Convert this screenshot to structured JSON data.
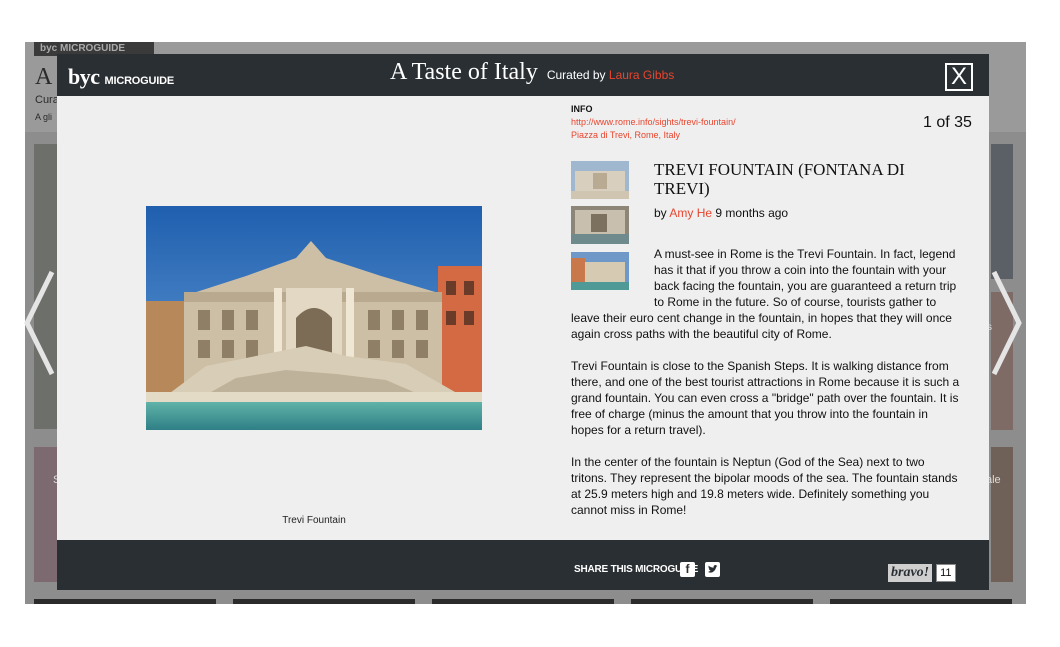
{
  "background": {
    "logo_text": "byc MICROGUIDE",
    "title_fragment": "A",
    "curated_fragment": "Cura",
    "glimpse_fragment": "A gli",
    "caption_left": "S",
    "caption_right": "ale",
    "caption_right_mid": "s"
  },
  "modal": {
    "brand": {
      "logo": "byc",
      "label": "MICROGUIDE"
    },
    "title": "A Taste of Italy",
    "curated_by_label": "Curated by",
    "curator": "Laura Gibbs",
    "close_label": "X"
  },
  "photo": {
    "caption": "Trevi Fountain"
  },
  "info": {
    "label": "INFO",
    "url": "http://www.rome.info/sights/trevi-fountain/",
    "address": "Piazza di Trevi, Rome, Italy"
  },
  "counter": "1 of 35",
  "entry": {
    "title": "TREVI FOUNTAIN (FONTANA DI TREVI)",
    "by_label": "by",
    "author": "Amy He",
    "time_ago": "9 months ago",
    "paragraphs": [
      "A must-see in Rome is the Trevi Fountain. In fact, legend has it that if you throw a coin into the fountain with your back facing the fountain, you are guaranteed a return trip to Rome in the future. So of course, tourists gather to leave their euro cent change in the fountain, in hopes that they will once again cross paths with the beautiful city of Rome.",
      "Trevi Fountain is close to the Spanish Steps. It is walking distance from there, and one of the best tourist attractions in Rome because it is such a grand fountain. You can even cross a \"bridge\" path over the fountain. It is free of charge (minus the amount that you throw into the fountain in hopes for a return travel).",
      "In the center of the fountain is Neptun (God of the Sea) next to two tritons. They represent the bipolar moods of the sea. The fountain stands at 25.9 meters high and 19.8 meters wide. Definitely something you cannot miss in Rome!"
    ],
    "para1_lines": [
      "A must-see in Rome is the Trevi Fountain. In fact, legend",
      "has it that if you throw a coin into the fountain with your",
      "back facing the fountain, you are guaranteed a return trip",
      "to Rome in the future. So of course, tourists gather to",
      "leave their euro cent change in the fountain, in hopes that they will once",
      "again cross paths with the beautiful city of Rome."
    ]
  },
  "footer": {
    "share_label": "SHARE THIS MICROGUIDE",
    "facebook_icon": "facebook-icon",
    "twitter_icon": "twitter-icon",
    "bravo_label": "bravo!",
    "bravo_count": "11"
  },
  "colors": {
    "accent": "#e8452e",
    "header_bg": "#2a2f33",
    "modal_bg": "#efefef"
  }
}
